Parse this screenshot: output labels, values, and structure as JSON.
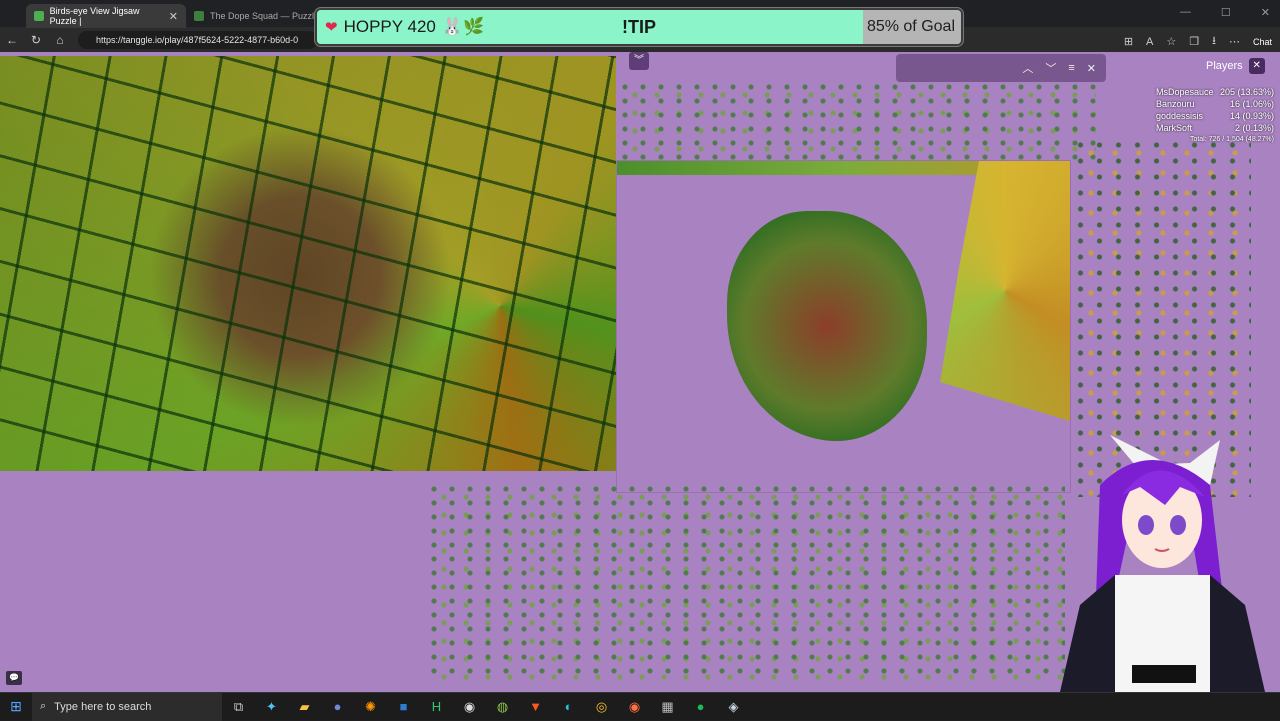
{
  "browser": {
    "tabs": [
      {
        "label": "Birds-eye View Jigsaw Puzzle |",
        "close": "✕"
      },
      {
        "label": "The Dope Squad — Puzzles"
      }
    ],
    "url": "https://tanggle.io/play/487f5624-5222-4877-b60d-0",
    "chat_label": "Chat"
  },
  "goal_banner": {
    "name": "HOPPY 420",
    "emoji": "🐰🌿",
    "center": "!TIP",
    "progress_text": "85% of Goal",
    "progress": 0.85
  },
  "puzzle_ui": {
    "players_label": "Players",
    "players": [
      {
        "name": "MsDopesauce",
        "score": "205 (13.63%)"
      },
      {
        "name": "Banzouru",
        "score": "16 (1.06%)"
      },
      {
        "name": "goddessisis",
        "score": "14 (0.93%)"
      },
      {
        "name": "MarkSoft",
        "score": "2 (0.13%)"
      }
    ],
    "total": "Total: 726 / 1,504 (48.27%)"
  },
  "taskbar": {
    "search_placeholder": "Type here to search"
  },
  "colors": {
    "background": "#a982c1",
    "banner": "#7ef0c2"
  }
}
